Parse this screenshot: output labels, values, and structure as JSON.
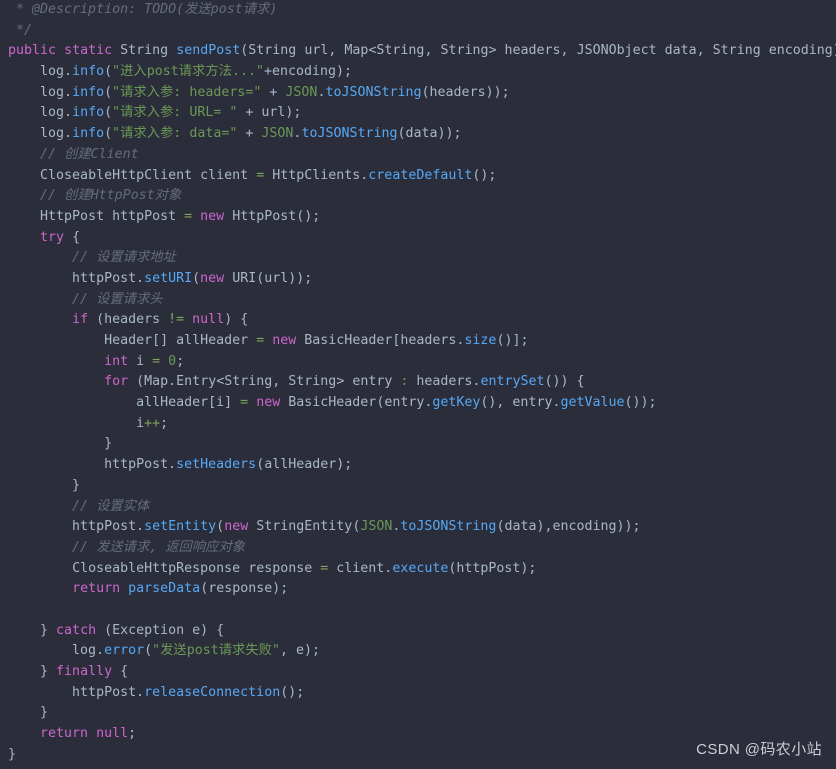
{
  "editor": {
    "theme_name": "darcula",
    "background": "#2b2d3a",
    "default_text_color": "#a9b7c6",
    "language": "java",
    "font_size_px": 13.3,
    "line_height_px": 20.7,
    "colors": {
      "comment": "#656d7a",
      "keyword": "#cc66cc",
      "method": "#56a8f5",
      "string": "#6a9955",
      "number": "#6a9955",
      "operator": "#7ea85b",
      "plain": "#a9b7c6"
    }
  },
  "code_lines": [
    "  * @Description: TODO(发送post请求)",
    "  */",
    " public static String sendPost(String url, Map<String, String> headers, JSONObject data, String encoding) {",
    "     log.info(\"进入post请求方法...\"+encoding);",
    "     log.info(\"请求入参: headers=\" + JSON.toJSONString(headers));",
    "     log.info(\"请求入参: URL= \" + url);",
    "     log.info(\"请求入参: data=\" + JSON.toJSONString(data));",
    "     // 创建Client",
    "     CloseableHttpClient client = HttpClients.createDefault();",
    "     // 创建HttpPost对象",
    "     HttpPost httpPost = new HttpPost();",
    "     try {",
    "         // 设置请求地址",
    "         httpPost.setURI(new URI(url));",
    "         // 设置请求头",
    "         if (headers != null) {",
    "             Header[] allHeader = new BasicHeader[headers.size()];",
    "             int i = 0;",
    "             for (Map.Entry<String, String> entry : headers.entrySet()) {",
    "                 allHeader[i] = new BasicHeader(entry.getKey(), entry.getValue());",
    "                 i++;",
    "             }",
    "             httpPost.setHeaders(allHeader);",
    "         }",
    "         // 设置实体",
    "         httpPost.setEntity(new StringEntity(JSON.toJSONString(data),encoding));",
    "         // 发送请求, 返回响应对象",
    "         CloseableHttpResponse response = client.execute(httpPost);",
    "         return parseData(response);",
    "",
    "     } catch (Exception e) {",
    "         log.error(\"发送post请求失败\", e);",
    "     } finally {",
    "         httpPost.releaseConnection();",
    "     }",
    "     return null;",
    " }"
  ],
  "watermark": {
    "text": "CSDN @码农小站"
  }
}
